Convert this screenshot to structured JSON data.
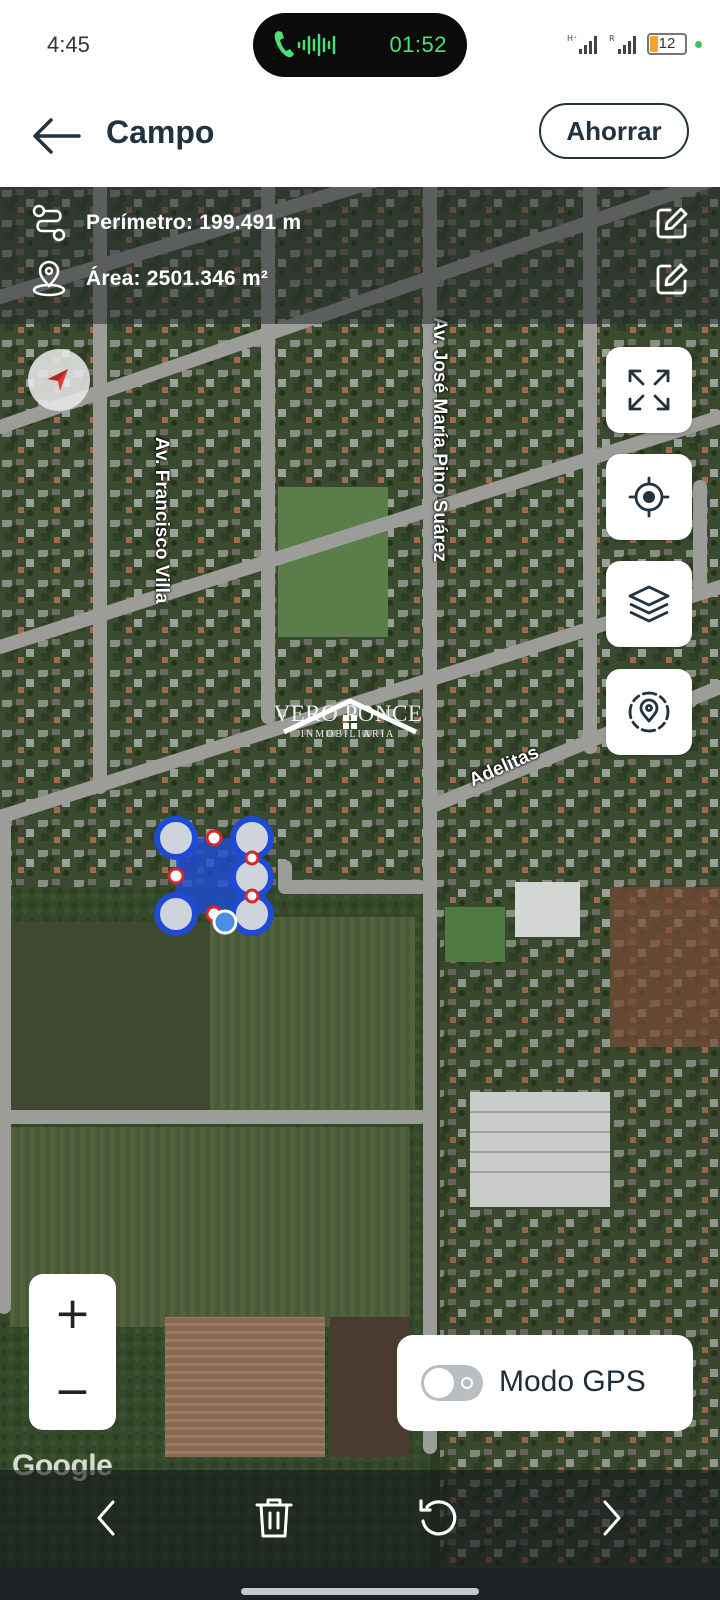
{
  "status_bar": {
    "time": "4:45",
    "call_timer": "01:52",
    "battery": "12"
  },
  "app_bar": {
    "title": "Campo",
    "save_label": "Ahorrar"
  },
  "info": {
    "perimeter": "Perímetro: 199.491 m",
    "area": "Área: 2501.346 m²"
  },
  "map": {
    "streets": [
      "Av. Francisco Villa",
      "Av. José María Pino Suárez",
      "Adelitas"
    ],
    "watermark_line1": "VERO PONCE",
    "watermark_line2": "INMOBILIARIA",
    "attribution": "Google",
    "polygon_fill": "#1e4bd6",
    "vertex_color": "#1e4bd6"
  },
  "zoom": {
    "plus": "+",
    "minus": "−"
  },
  "gps": {
    "label": "Modo GPS",
    "enabled": false
  },
  "icons": {
    "back": "arrow-left-icon",
    "route": "route-icon",
    "location": "location-pin-icon",
    "edit": "edit-icon",
    "compass": "compass-icon",
    "fullscreen": "expand-icon",
    "locate": "crosshair-icon",
    "layers": "layers-icon",
    "gps_target": "target-icon",
    "prev": "chevron-left-icon",
    "delete": "trash-icon",
    "undo": "undo-icon",
    "next": "chevron-right-icon"
  }
}
